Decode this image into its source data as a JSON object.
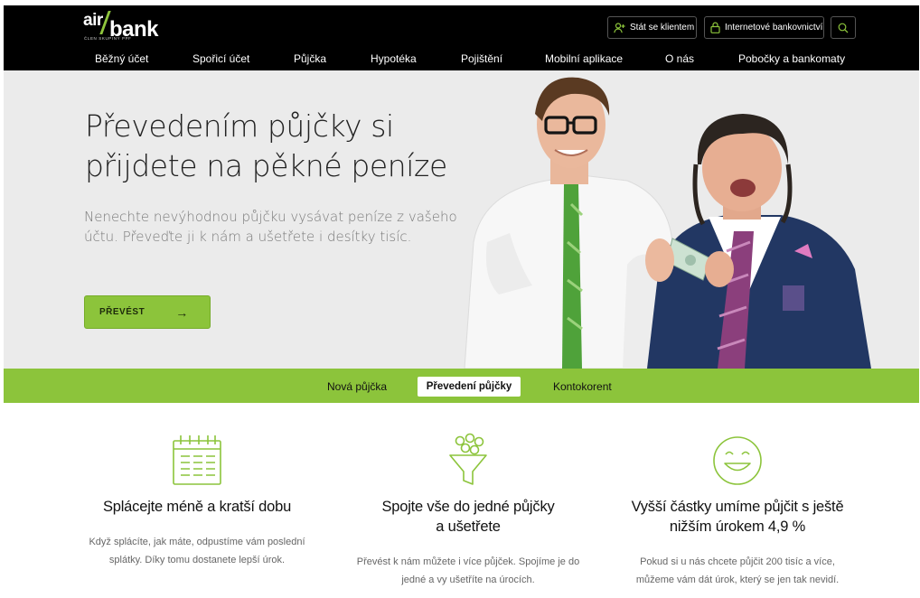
{
  "brand": {
    "logo_top": "air",
    "logo_main": "bank",
    "logo_sub": "ČLEN SKUPINY PPF",
    "accent_color": "#8cc43b",
    "header_color": "#000000"
  },
  "header": {
    "client_button": "Stát se klientem",
    "client_icon": "add-user-icon",
    "ib_button": "Internetové bankovnictví",
    "ib_icon": "lock-icon",
    "search_icon": "search-icon"
  },
  "nav": {
    "items": [
      {
        "label": "Běžný účet"
      },
      {
        "label": "Spořicí účet"
      },
      {
        "label": "Půjčka"
      },
      {
        "label": "Hypotéka"
      },
      {
        "label": "Pojištění"
      },
      {
        "label": "Mobilní aplikace"
      },
      {
        "label": "O nás"
      },
      {
        "label": "Pobočky a bankomaty"
      }
    ]
  },
  "hero": {
    "title_line1": "Převedením půjčky si",
    "title_line2": "přijdete na pěkné peníze",
    "subtitle": "Nenechte nevýhodnou půjčku vysávat peníze z vašeho účtu. Převeďte ji k nám a ušetřete i desítky tisíc.",
    "cta_label": "PŘEVÉST",
    "cta_arrow": "→"
  },
  "tabs": {
    "items": [
      {
        "label": "Nová půjčka",
        "active": false
      },
      {
        "label": "Převedení půjčky",
        "active": true
      },
      {
        "label": "Kontokorent",
        "active": false
      }
    ]
  },
  "features": [
    {
      "icon": "calendar-icon",
      "title": "Splácejte méně a kratší dobu",
      "text": "Když splácíte, jak máte, odpustíme vám poslední splátky. Díky tomu dostanete lepší úrok."
    },
    {
      "icon": "funnel-icon",
      "title_line1": "Spojte vše do jedné půjčky",
      "title_line2": "a ušetřete",
      "text": "Převést k nám můžete i více půjček. Spojíme je do jedné a vy ušetříte na úrocích."
    },
    {
      "icon": "smiley-icon",
      "title_line1": "Vyšší částky umíme půjčit s ještě",
      "title_line2": "nižším úrokem 4,9 %",
      "text": "Pokud si u nás chcete půjčit 200 tisíc a více, můžeme vám dát úrok, který se jen tak nevidí."
    }
  ]
}
